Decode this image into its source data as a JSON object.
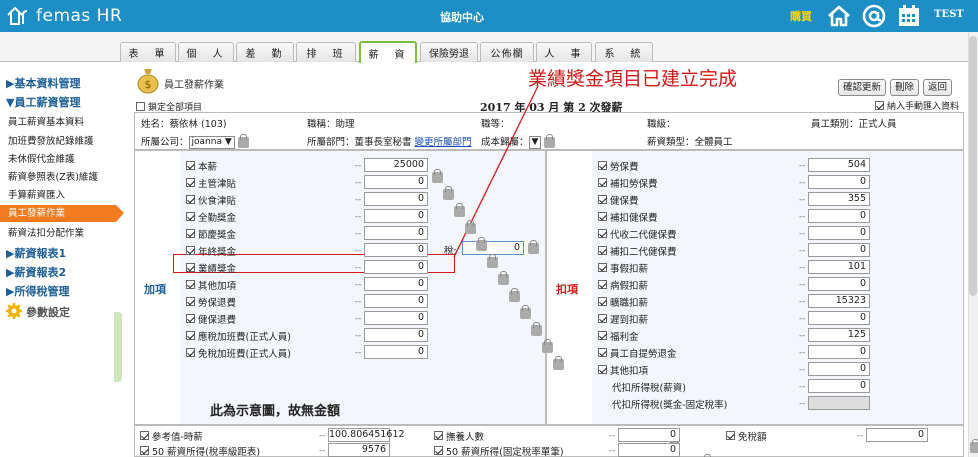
{
  "header": {
    "logo": "femas HR",
    "title": "協助中心",
    "buy": "購買",
    "user": "TEST",
    "colors": {
      "bar": "#1d8fc6",
      "buy": "#ffd200"
    }
  },
  "tabs": [
    "表　單",
    "個　人",
    "差　勤",
    "排　班",
    "薪　資",
    "保險勞退",
    "公佈欄",
    "人　事",
    "系　統"
  ],
  "active_tab": "薪　資",
  "sidebar": {
    "h1": "▶基本資料管理",
    "h2": "▼員工薪資管理",
    "items": [
      "員工薪資基本資料",
      "加班費發放紀錄維護",
      "未休假代金維護",
      "薪資參照表(Z表)維護",
      "手算薪資匯入",
      "員工發薪作業",
      "薪資法扣分配作業"
    ],
    "active_index": 5,
    "h3": "▶薪資報表1",
    "h4": "▶薪資報表2",
    "h5": "▶所得稅管理",
    "param": "參數設定"
  },
  "main": {
    "title": "員工發薪作業",
    "lock_all": "鎖定全部項目",
    "period": "2017 年 03 月  第 2 次發薪",
    "buttons": [
      "確認更新",
      "刪除",
      "返回"
    ],
    "manual": "納入手動匯入資料",
    "annotation": "業績獎金項目已建立完成",
    "demo_note": "此為示意圖，故無金額"
  },
  "info": {
    "name": "姓名：蔡依林 (103)",
    "title": "職稱：助理",
    "grade": "職等：",
    "level": "職級：",
    "emptype": "員工類別：正式人員",
    "company_label": "所屬公司：",
    "company": "joanna ▼",
    "dept": "所屬部門：董事長室秘書",
    "dept_link": "變更所屬部門",
    "cost_label": "成本歸屬：",
    "cost": "▼",
    "saltype": "薪資類型：全體員工"
  },
  "add": {
    "label": "加項",
    "items": [
      {
        "name": "本薪",
        "value": "25000"
      },
      {
        "name": "主管津貼",
        "value": "0"
      },
      {
        "name": "伙食津貼",
        "value": "0"
      },
      {
        "name": "全勤獎金",
        "value": "0"
      },
      {
        "name": "節慶獎金",
        "value": "0"
      },
      {
        "name": "年終獎金",
        "value": "0"
      },
      {
        "name": "業績獎金",
        "value": "0"
      },
      {
        "name": "其他加項",
        "value": "0"
      },
      {
        "name": "勞保退費",
        "value": "0"
      },
      {
        "name": "健保退費",
        "value": "0"
      },
      {
        "name": "應稅加班費(正式人員)",
        "value": "0"
      },
      {
        "name": "免稅加班費(正式人員)",
        "value": "0"
      }
    ],
    "tax_label": "稅:",
    "tax_value": "0"
  },
  "ded": {
    "label": "扣項",
    "items": [
      {
        "name": "勞保費",
        "value": "504"
      },
      {
        "name": "補扣勞保費",
        "value": "0"
      },
      {
        "name": "健保費",
        "value": "355"
      },
      {
        "name": "補扣健保費",
        "value": "0"
      },
      {
        "name": "代收二代健保費",
        "value": "0"
      },
      {
        "name": "補扣二代健保費",
        "value": "0"
      },
      {
        "name": "事假扣薪",
        "value": "101"
      },
      {
        "name": "病假扣薪",
        "value": "0"
      },
      {
        "name": "曠職扣薪",
        "value": "15323"
      },
      {
        "name": "遲到扣薪",
        "value": "0"
      },
      {
        "name": "福利金",
        "value": "125"
      },
      {
        "name": "員工自提勞退金",
        "value": "0"
      },
      {
        "name": "其他扣項",
        "value": "0"
      },
      {
        "name": "代扣所得稅(薪資)",
        "value": "0"
      },
      {
        "name": "代扣所得稅(獎金-固定稅率)",
        "value": ""
      }
    ]
  },
  "bottom": {
    "r1": [
      {
        "name": "參考值-時薪",
        "value": "100.806451612"
      },
      {
        "name": "撫養人數",
        "value": "0"
      },
      {
        "name": "免稅額",
        "value": "0"
      }
    ],
    "r2": [
      {
        "name": "50 薪資所得(稅率級距表)",
        "value": "9576"
      },
      {
        "name": "50 薪資所得(固定稅率單筆)",
        "value": "0"
      }
    ]
  }
}
